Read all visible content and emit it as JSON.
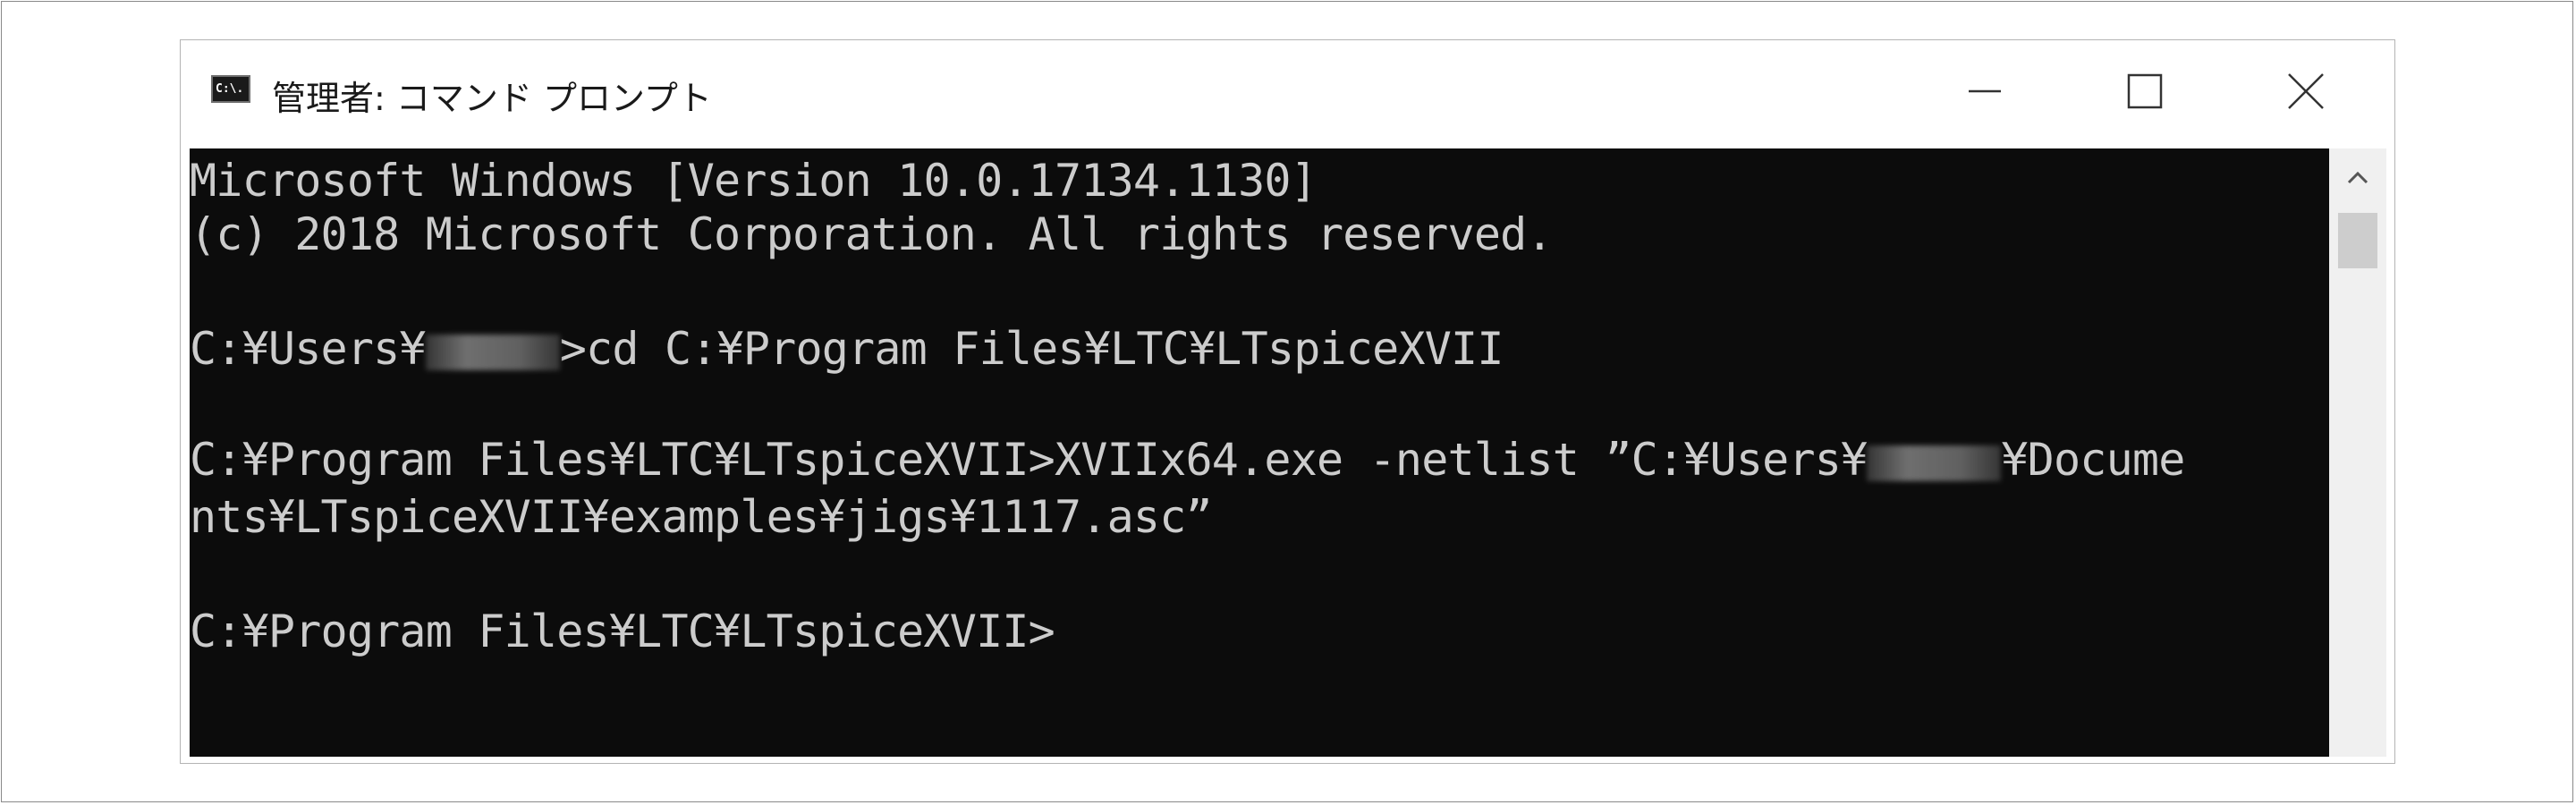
{
  "window": {
    "title": "管理者: コマンド プロンプト",
    "icon": "cmd-icon",
    "icon_text": "C:\\.",
    "buttons": {
      "minimize": "minimize-icon",
      "maximize": "maximize-icon",
      "close": "close-icon"
    }
  },
  "terminal": {
    "line1": "Microsoft Windows [Version 10.0.17134.1130]",
    "line2": "(c) 2018 Microsoft Corporation. All rights reserved.",
    "line3_before": "C:¥Users¥",
    "line3_after": ">cd C:¥Program Files¥LTC¥LTspiceXVII",
    "line4_before": "C:¥Program Files¥LTC¥LTspiceXVII>XVIIx64.exe -netlist ”C:¥Users¥",
    "line4_after": "¥Docume",
    "line5": "nts¥LTspiceXVII¥examples¥jigs¥1117.asc”",
    "line6": "C:¥Program Files¥LTC¥LTspiceXVII>"
  },
  "colors": {
    "terminal_background": "#0c0c0c",
    "terminal_text": "#cccccc",
    "titlebar": "#ffffff"
  }
}
